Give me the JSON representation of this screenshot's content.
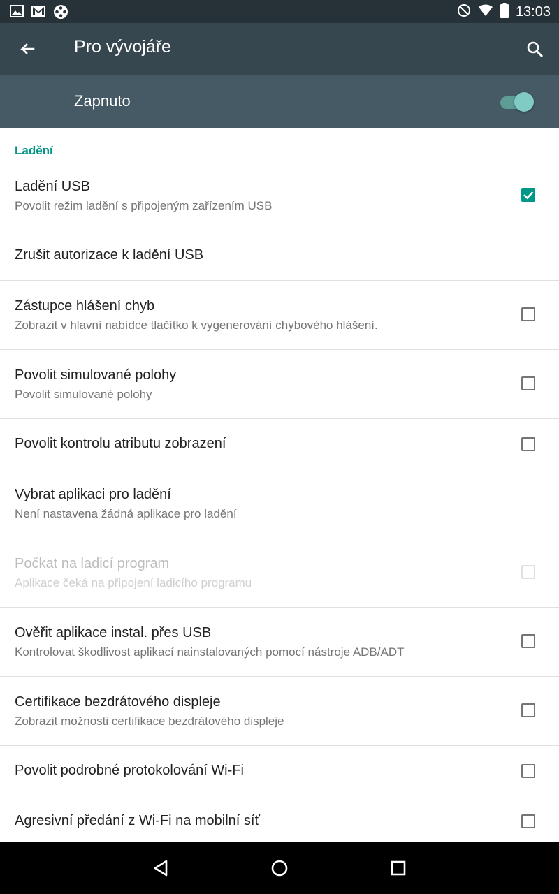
{
  "status_bar": {
    "time": "13:03",
    "left_icons": [
      "gallery-icon",
      "gmail-icon",
      "film-reel-icon"
    ],
    "right_icons": [
      "do-not-disturb-icon",
      "wifi-icon",
      "battery-icon"
    ]
  },
  "app_bar": {
    "title": "Pro vývojáře",
    "back_icon": "arrow-back-icon",
    "search_icon": "search-icon"
  },
  "master_switch": {
    "label": "Zapnuto",
    "on": true
  },
  "section": {
    "header": "Ladění"
  },
  "items": [
    {
      "title": "Ladění USB",
      "subtitle": "Povolit režim ladění s připojeným zařízením USB",
      "checkbox": "checked"
    },
    {
      "title": "Zrušit autorizace k ladění USB",
      "subtitle": "",
      "checkbox": "none"
    },
    {
      "title": "Zástupce hlášení chyb",
      "subtitle": "Zobrazit v hlavní nabídce tlačítko k vygenerování chybového hlášení.",
      "checkbox": "unchecked"
    },
    {
      "title": "Povolit simulované polohy",
      "subtitle": "Povolit simulované polohy",
      "checkbox": "unchecked"
    },
    {
      "title": "Povolit kontrolu atributu zobrazení",
      "subtitle": "",
      "checkbox": "unchecked"
    },
    {
      "title": "Vybrat aplikaci pro ladění",
      "subtitle": "Není nastavena žádná aplikace pro ladění",
      "checkbox": "none"
    },
    {
      "title": "Počkat na ladicí program",
      "subtitle": "Aplikace čeká na připojení ladicího programu",
      "checkbox": "disabled"
    },
    {
      "title": "Ověřit aplikace instal. přes USB",
      "subtitle": "Kontrolovat škodlivost aplikací nainstalovaných pomocí nástroje ADB/ADT",
      "checkbox": "unchecked"
    },
    {
      "title": "Certifikace bezdrátového displeje",
      "subtitle": "Zobrazit možnosti certifikace bezdrátového displeje",
      "checkbox": "unchecked"
    },
    {
      "title": "Povolit podrobné protokolování Wi-Fi",
      "subtitle": "",
      "checkbox": "unchecked"
    },
    {
      "title": "Agresivní předání z Wi-Fi na mobilní síť",
      "subtitle": "",
      "checkbox": "unchecked"
    }
  ],
  "nav_bar": {
    "back_icon": "nav-back-icon",
    "home_icon": "nav-home-icon",
    "recents_icon": "nav-recents-icon"
  },
  "colors": {
    "accent": "#009688",
    "app_bar": "#37474f",
    "switch_bar": "#455a64",
    "status_bar": "#263238"
  }
}
